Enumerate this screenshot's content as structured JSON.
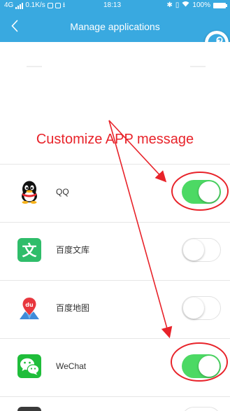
{
  "status_bar": {
    "network": "4G",
    "speed": "0.1K/s",
    "time": "18:13",
    "battery": "100%"
  },
  "header": {
    "title": "Manage applications"
  },
  "annotation": {
    "text": "Customize APP message",
    "color": "#e8232a"
  },
  "colors": {
    "accent": "#39a9e0",
    "toggle_on": "#4cd964"
  },
  "apps": [
    {
      "name": "QQ",
      "icon": "qq-penguin-icon",
      "enabled": true
    },
    {
      "name": "百度文库",
      "icon": "baidu-wenku-icon",
      "enabled": false
    },
    {
      "name": "百度地图",
      "icon": "baidu-map-icon",
      "enabled": false
    },
    {
      "name": "WeChat",
      "icon": "wechat-icon",
      "enabled": true
    }
  ]
}
